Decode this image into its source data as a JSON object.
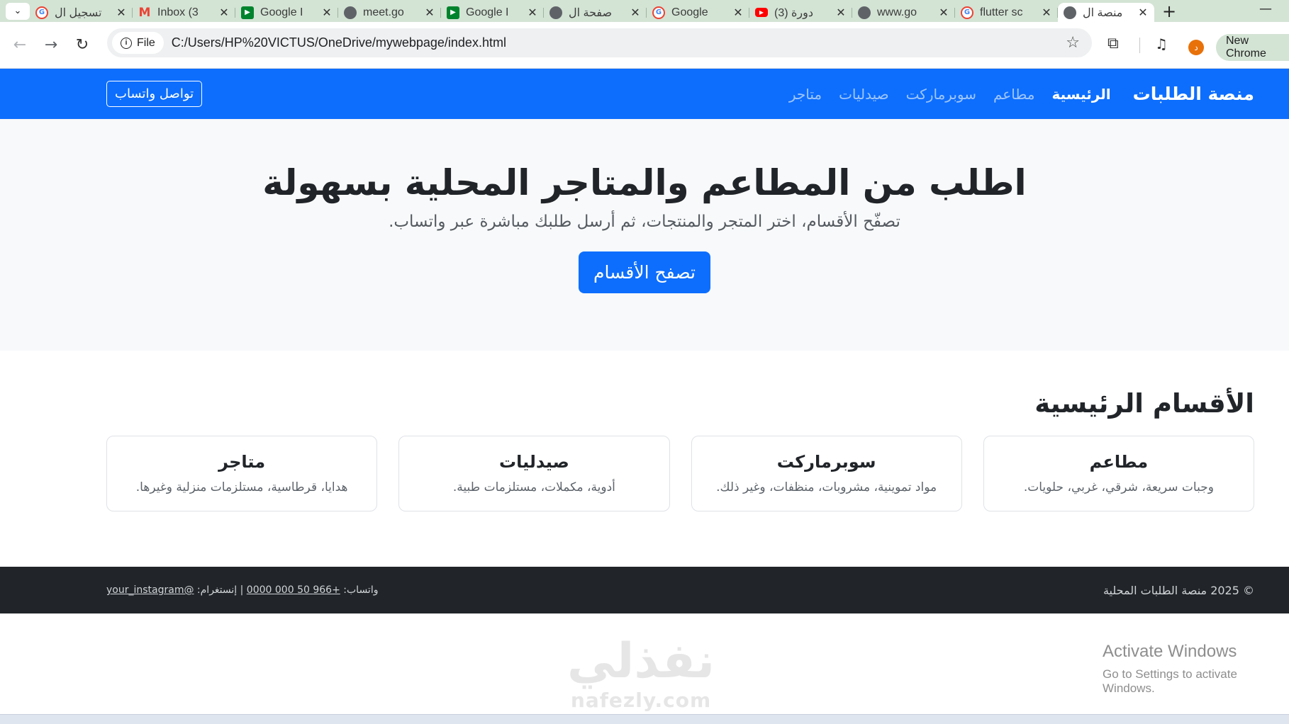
{
  "browser": {
    "tabs": [
      {
        "title": "تسجيل ال",
        "icon": "google-icon"
      },
      {
        "title": "Inbox (3",
        "icon": "gmail-icon"
      },
      {
        "title": "Google I",
        "icon": "google-meet-icon"
      },
      {
        "title": "meet.go",
        "icon": "globe-icon"
      },
      {
        "title": "Google I",
        "icon": "google-meet-icon"
      },
      {
        "title": "صفحة ال",
        "icon": "globe-icon"
      },
      {
        "title": "Google",
        "icon": "google-icon"
      },
      {
        "title": "(3) دورة",
        "icon": "youtube-icon"
      },
      {
        "title": "www.go",
        "icon": "globe-icon"
      },
      {
        "title": "flutter sc",
        "icon": "google-icon"
      },
      {
        "title": "منصة ال",
        "icon": "globe-icon",
        "active": true
      }
    ],
    "file_chip": "File",
    "url": "C:/Users/HP%20VICTUS/OneDrive/mywebpage/index.html",
    "profile_initial": "د",
    "new_chrome_label": "New Chrome"
  },
  "site": {
    "brand": "منصة الطلبات",
    "nav": [
      "الرئيسية",
      "مطاعم",
      "سوبرماركت",
      "صيدليات",
      "متاجر"
    ],
    "whatsapp_button": "تواصل واتساب"
  },
  "hero": {
    "title": "اطلب من المطاعم والمتاجر المحلية بسهولة",
    "subtitle": "تصفّح الأقسام، اختر المتجر والمنتجات، ثم أرسل طلبك مباشرة عبر واتساب.",
    "cta": "تصفح الأقسام"
  },
  "sections": {
    "title": "الأقسام الرئيسية",
    "cards": [
      {
        "title": "مطاعم",
        "desc": "وجبات سريعة، شرقي، غربي، حلويات."
      },
      {
        "title": "سوبرماركت",
        "desc": "مواد تموينية، مشروبات، منظفات، وغير ذلك."
      },
      {
        "title": "صيدليات",
        "desc": "أدوية، مكملات، مستلزمات طبية."
      },
      {
        "title": "متاجر",
        "desc": "هدايا، قرطاسية، مستلزمات منزلية وغيرها."
      }
    ]
  },
  "footer": {
    "copyright": "© 2025 منصة الطلبات المحلية",
    "whatsapp_label": "واتساب:",
    "whatsapp_number": "+966 50 000 0000",
    "instagram_label": "| إنستغرام:",
    "instagram_handle": "@your_instagram"
  },
  "overlay": {
    "activate_title": "Activate Windows",
    "activate_sub": "Go to Settings to activate Windows.",
    "watermark_ar": "نفذلي",
    "watermark_en": "nafezly.com"
  },
  "colors": {
    "primary": "#0d6efd",
    "hero_bg": "#f8f9fa",
    "footer_bg": "#212529",
    "tabbar_bg": "#d3e3d4"
  }
}
